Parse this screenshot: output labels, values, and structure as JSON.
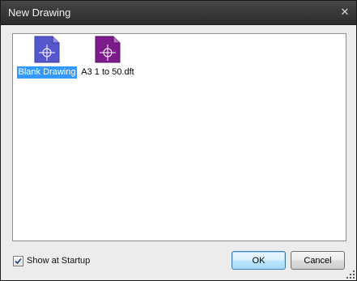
{
  "window": {
    "title": "New Drawing",
    "close_glyph": "✕"
  },
  "templates": [
    {
      "label": "Blank Drawing",
      "icon": "blank-drawing-icon",
      "color": "#5555cc",
      "selected": true
    },
    {
      "label": "A3 1 to 50.dft",
      "icon": "drawing-template-icon",
      "color": "#7d1a8c",
      "selected": false
    }
  ],
  "footer": {
    "show_at_startup_label": "Show at Startup",
    "show_at_startup_checked": true,
    "ok_label": "OK",
    "cancel_label": "Cancel"
  },
  "colors": {
    "selection": "#3399ff",
    "titlebar": "#3a3a3a"
  }
}
